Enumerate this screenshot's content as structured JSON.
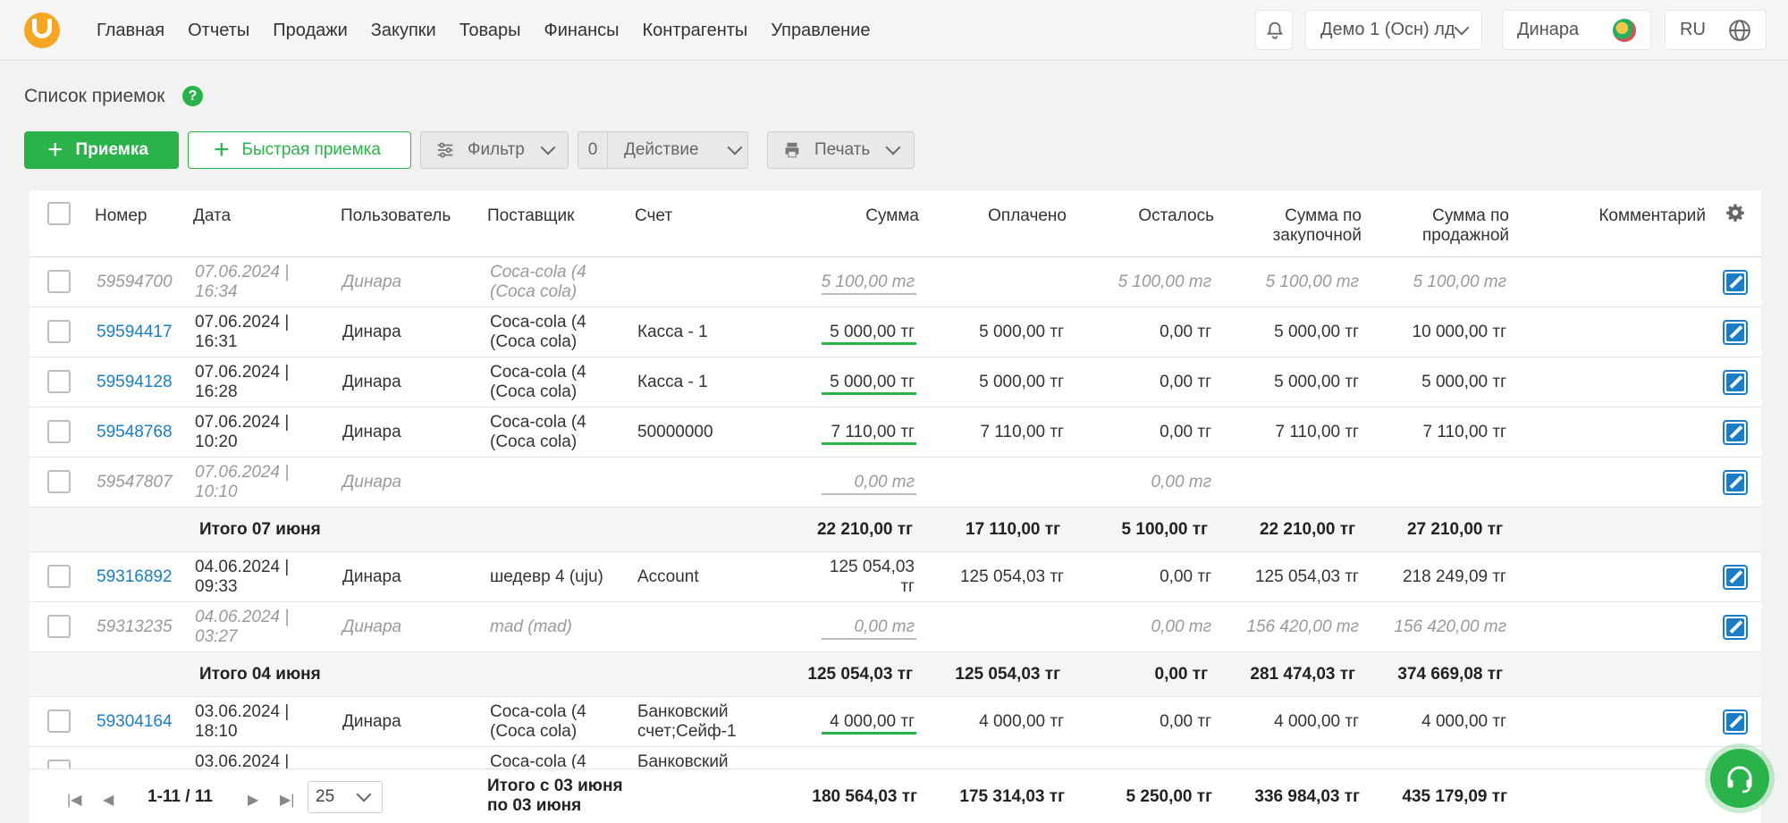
{
  "nav": {
    "items": [
      "Главная",
      "Отчеты",
      "Продажи",
      "Закупки",
      "Товары",
      "Финансы",
      "Контрагенты",
      "Управление"
    ],
    "company": "Демо 1 (Осн) лд",
    "user": "Динара",
    "language": "RU"
  },
  "page": {
    "title": "Список приемок",
    "help": "?"
  },
  "toolbar": {
    "add_label": "Приемка",
    "quick_add_label": "Быстрая приемка",
    "filter_label": "Фильтр",
    "selected_count": "0",
    "action_label": "Действие",
    "print_label": "Печать"
  },
  "table": {
    "headers": {
      "number": "Номер",
      "date": "Дата",
      "user": "Пользователь",
      "supplier": "Поставщик",
      "account": "Счет",
      "sum": "Сумма",
      "paid": "Оплачено",
      "left": "Осталось",
      "sum_purchase_1": "Сумма по",
      "sum_purchase_2": "закупочной",
      "sum_sale_1": "Сумма по",
      "sum_sale_2": "продажной",
      "comment": "Комментарий"
    },
    "rows": [
      {
        "number": "59594700",
        "date1": "07.06.2024 |",
        "date2": "16:34",
        "user": "Динара",
        "supplier1": "Coca-cola (4",
        "supplier2": "(Coca cola)",
        "account1": "",
        "account2": "",
        "sum": "5 100,00 тг",
        "paid": "",
        "left": "5 100,00 тг",
        "purchase": "5 100,00 тг",
        "sale": "5 100,00 тг"
      },
      {
        "number": "59594417",
        "date1": "07.06.2024 |",
        "date2": "16:31",
        "user": "Динара",
        "supplier1": "Coca-cola (4",
        "supplier2": "(Coca cola)",
        "account1": "Касса - 1",
        "account2": "",
        "sum": "5 000,00 тг",
        "paid": "5 000,00 тг",
        "left": "0,00 тг",
        "purchase": "5 000,00 тг",
        "sale": "10 000,00 тг"
      },
      {
        "number": "59594128",
        "date1": "07.06.2024 |",
        "date2": "16:28",
        "user": "Динара",
        "supplier1": "Coca-cola (4",
        "supplier2": "(Coca cola)",
        "account1": "Касса - 1",
        "account2": "",
        "sum": "5 000,00 тг",
        "paid": "5 000,00 тг",
        "left": "0,00 тг",
        "purchase": "5 000,00 тг",
        "sale": "5 000,00 тг"
      },
      {
        "number": "59548768",
        "date1": "07.06.2024 |",
        "date2": "10:20",
        "user": "Динара",
        "supplier1": "Coca-cola (4",
        "supplier2": "(Coca cola)",
        "account1": "50000000",
        "account2": "",
        "sum": "7 110,00 тг",
        "paid": "7 110,00 тг",
        "left": "0,00 тг",
        "purchase": "7 110,00 тг",
        "sale": "7 110,00 тг"
      },
      {
        "number": "59547807",
        "date1": "07.06.2024 |",
        "date2": "10:10",
        "user": "Динара",
        "supplier1": "",
        "supplier2": "",
        "account1": "",
        "account2": "",
        "sum": "0,00 тг",
        "paid": "",
        "left": "0,00 тг",
        "purchase": "",
        "sale": ""
      },
      {
        "number": "59316892",
        "date1": "04.06.2024 |",
        "date2": "09:33",
        "user": "Динара",
        "supplier1": "шедевр 4 (uju)",
        "supplier2": "",
        "account1": "Account",
        "account2": "",
        "sum1": "125 054,03",
        "sum2": "тг",
        "paid": "125 054,03 тг",
        "left": "0,00 тг",
        "purchase": "125 054,03 тг",
        "sale": "218 249,09 тг"
      },
      {
        "number": "59313235",
        "date1": "04.06.2024 |",
        "date2": "03:27",
        "user": "Динара",
        "supplier1": "mad (mad)",
        "supplier2": "",
        "account1": "",
        "account2": "",
        "sum": "0,00 тг",
        "paid": "",
        "left": "0,00 тг",
        "purchase": "156 420,00 тг",
        "sale": "156 420,00 тг"
      },
      {
        "number": "59304164",
        "date1": "03.06.2024 |",
        "date2": "18:10",
        "user": "Динара",
        "supplier1": "Coca-cola (4",
        "supplier2": "(Coca cola)",
        "account1": "Банковский",
        "account2": "счет;Сейф-1",
        "sum": "4 000,00 тг",
        "paid": "4 000,00 тг",
        "left": "0,00 тг",
        "purchase": "4 000,00 тг",
        "sale": "4 000,00 тг"
      },
      {
        "number": "",
        "date1": "03.06.2024 |",
        "date2": "",
        "user": "",
        "supplier1": "Coca-cola (4",
        "supplier2": "",
        "account1": "Банковский",
        "account2": "",
        "sum": "",
        "paid": "",
        "left": "",
        "purchase": "",
        "sale": ""
      }
    ],
    "totals": [
      {
        "label": "Итого 07 июня",
        "sum": "22 210,00 тг",
        "paid": "17 110,00 тг",
        "left": "5 100,00 тг",
        "purchase": "22 210,00 тг",
        "sale": "27 210,00 тг"
      },
      {
        "label": "Итого 04 июня",
        "sum": "125 054,03 тг",
        "paid": "125 054,03 тг",
        "left": "0,00 тг",
        "purchase": "281 474,03 тг",
        "sale": "374 669,08 тг"
      }
    ]
  },
  "footer": {
    "range": "1-11 / 11",
    "per_page": "25",
    "total_label_1": "Итого с 03 июня",
    "total_label_2": "по 03 июня",
    "sum": "180 564,03 тг",
    "paid": "175 314,03 тг",
    "left": "5 250,00 тг",
    "purchase": "336 984,03 тг",
    "sale": "435 179,09 тг"
  },
  "colors": {
    "accent": "#2ab34b",
    "link": "#1a7ec6",
    "logo": "#f6a623"
  }
}
